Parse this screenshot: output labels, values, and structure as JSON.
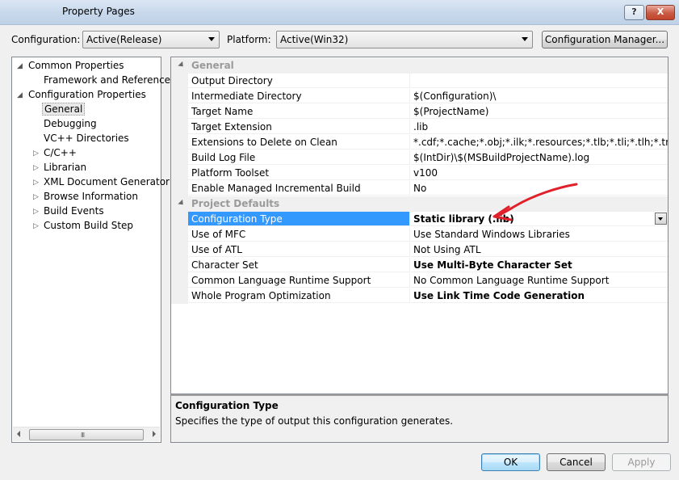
{
  "window": {
    "title": "Property Pages",
    "help_label": "?",
    "close_label": "X"
  },
  "toolbar": {
    "configuration_label": "Configuration:",
    "configuration_value": "Active(Release)",
    "platform_label": "Platform:",
    "platform_value": "Active(Win32)",
    "config_manager_label": "Configuration Manager..."
  },
  "tree": {
    "items": [
      {
        "label": "Common Properties"
      },
      {
        "label": "Framework and References"
      },
      {
        "label": "Configuration Properties"
      },
      {
        "label": "General"
      },
      {
        "label": "Debugging"
      },
      {
        "label": "VC++ Directories"
      },
      {
        "label": "C/C++"
      },
      {
        "label": "Librarian"
      },
      {
        "label": "XML Document Generator"
      },
      {
        "label": "Browse Information"
      },
      {
        "label": "Build Events"
      },
      {
        "label": "Custom Build Step"
      }
    ],
    "scroll_grip": "III"
  },
  "grid": {
    "categories": [
      {
        "label": "General"
      },
      {
        "label": "Project Defaults"
      }
    ],
    "general_rows": [
      {
        "name": "Output Directory",
        "value": ""
      },
      {
        "name": "Intermediate Directory",
        "value": "$(Configuration)\\"
      },
      {
        "name": "Target Name",
        "value": "$(ProjectName)"
      },
      {
        "name": "Target Extension",
        "value": ".lib"
      },
      {
        "name": "Extensions to Delete on Clean",
        "value": "*.cdf;*.cache;*.obj;*.ilk;*.resources;*.tlb;*.tli;*.tlh;*.tmp;*.rsp;*"
      },
      {
        "name": "Build Log File",
        "value": "$(IntDir)\\$(MSBuildProjectName).log"
      },
      {
        "name": "Platform Toolset",
        "value": "v100"
      },
      {
        "name": "Enable Managed Incremental Build",
        "value": "No"
      }
    ],
    "defaults_rows": [
      {
        "name": "Configuration Type",
        "value": "Static library (.lib)"
      },
      {
        "name": "Use of MFC",
        "value": "Use Standard Windows Libraries"
      },
      {
        "name": "Use of ATL",
        "value": "Not Using ATL"
      },
      {
        "name": "Character Set",
        "value": "Use Multi-Byte Character Set"
      },
      {
        "name": "Common Language Runtime Support",
        "value": "No Common Language Runtime Support"
      },
      {
        "name": "Whole Program Optimization",
        "value": "Use Link Time Code Generation"
      }
    ]
  },
  "description": {
    "title": "Configuration Type",
    "text": "Specifies the type of output this configuration generates."
  },
  "buttons": {
    "ok": "OK",
    "cancel": "Cancel",
    "apply": "Apply"
  },
  "colors": {
    "selection": "#3399ff",
    "annotation_arrow": "#e0202a"
  }
}
